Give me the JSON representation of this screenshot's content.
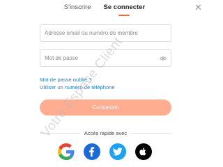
{
  "tabs": [
    {
      "label": "S'inscrire",
      "active": false
    },
    {
      "label": "Se connecter",
      "active": true
    }
  ],
  "form": {
    "email_placeholder": "Adresse email ou numéro de membre",
    "email_value": "",
    "password_placeholder": "Mot de passe",
    "password_value": "",
    "forgot_password_link": "Mot de passe oublié ?",
    "use_phone_link": "Utiliser un numéro de téléphone",
    "submit_label": "Connexion"
  },
  "quick_access": {
    "label": "Accès rapide avec",
    "providers": [
      {
        "name": "Google",
        "icon": "google-icon",
        "color": "#4285f4"
      },
      {
        "name": "Facebook",
        "icon": "facebook-icon",
        "color": "#1a6bd6"
      },
      {
        "name": "Twitter",
        "icon": "twitter-icon",
        "color": "#1da1f2"
      },
      {
        "name": "Apple",
        "icon": "apple-icon",
        "color": "#000000"
      }
    ]
  },
  "watermark": "Votre Espace Client",
  "colors": {
    "accent": "#ff6a3d",
    "button_bg": "#ffad91",
    "link": "#1e7fcb",
    "border": "#dcdcdc"
  },
  "icons": {
    "close": "close-icon",
    "password_toggle": "eye-icon"
  }
}
